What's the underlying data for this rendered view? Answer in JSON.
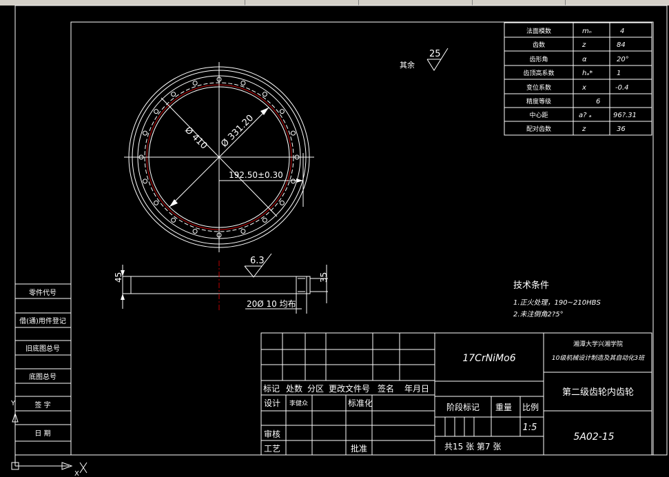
{
  "params": [
    {
      "name": "法面模数",
      "sym": "mₙ",
      "val": "4"
    },
    {
      "name": "齿数",
      "sym": "z",
      "val": "84"
    },
    {
      "name": "齿形角",
      "sym": "α",
      "val": "20°"
    },
    {
      "name": "齿顶高系数",
      "sym": "hₐ*",
      "val": "1"
    },
    {
      "name": "变位系数",
      "sym": "x",
      "val": "-0.4"
    },
    {
      "name": "精度等级",
      "sym": "",
      "val": "6"
    },
    {
      "name": "中心距",
      "sym": "a? ₐ",
      "val": "96?.31"
    },
    {
      "name": "配对齿数",
      "sym": "z",
      "val": "36"
    }
  ],
  "roughness_rest": {
    "label": "其余",
    "value": "25"
  },
  "dims": {
    "outer_dia": "Ø 410",
    "inner_dia": "Ø 331.20",
    "radius": "192.50±0.30",
    "thickness": "45",
    "inner_thick": "35",
    "holes": "20Ø 10 均布",
    "roughness_side": "6.3"
  },
  "tech": {
    "title": "技术条件",
    "items": [
      "1.正火处理，190~210HBS",
      "2.未注倒角2?5°"
    ]
  },
  "left_strip": [
    "零件代号",
    "借(通)用件登记",
    "旧底图总号",
    "底图总号",
    "签    字",
    "日    期"
  ],
  "title_block": {
    "material": "17CrNiMo6",
    "school": "湘潭大学兴湘学院",
    "class_name": "10级机械设计制造及其自动化3班",
    "part_name": "第二级齿轮内齿轮",
    "drawing_no": "5A02-15",
    "scale": "1:5",
    "sheets": "共15 张 第7 张",
    "rev_headers": [
      "标记",
      "处数",
      "分区",
      "更改文件号",
      "签名",
      "年月日"
    ],
    "design_label": "设计",
    "designer": "李健众",
    "standard_label": "标准化",
    "review_label": "审核",
    "process_label": "工艺",
    "approve_label": "批准",
    "stage_label": "阶段标记",
    "weight_label": "重量",
    "scale_label": "比例"
  },
  "ucs": {
    "y": "Y",
    "x": "X"
  }
}
